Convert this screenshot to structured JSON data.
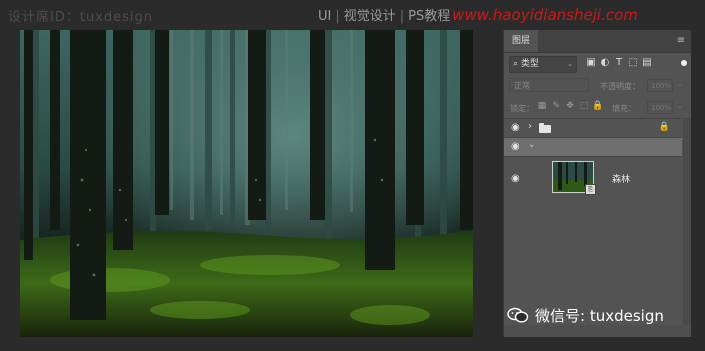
{
  "header": {
    "watermark_left": "设计席ID：tuxdesign",
    "nav_ui": "UI",
    "sep": "|",
    "nav_visual": "视觉设计",
    "nav_ps": "PS教程",
    "url": "www.haoyidiansheji.com"
  },
  "panel": {
    "tab_label": "图层",
    "menu_icon": "≡",
    "filter": {
      "icon": "⌕",
      "label": "类型",
      "arrow": "⌄"
    },
    "filter_icons": [
      "▣",
      "◐",
      "T",
      "⬚",
      "▤"
    ],
    "blend_mode": "正常",
    "opacity_label": "不透明度：",
    "opacity_value": "100%",
    "lock_label": "锁定：",
    "lock_icons": [
      "▦",
      "✎",
      "✥",
      "⬚",
      "🔒"
    ],
    "fill_label": "填充：",
    "fill_value": "100%",
    "dropdown_arrow": "⌄",
    "layers": [
      {
        "type": "group",
        "visible": true,
        "chevron": "›",
        "locked": true,
        "lock_icon": "🔒"
      },
      {
        "type": "group-open",
        "visible": true,
        "chevron": "⌄"
      },
      {
        "type": "image",
        "visible": true,
        "name": "森林",
        "badge": "⎘"
      }
    ]
  },
  "watermark": {
    "text": "微信号: tuxdesign"
  },
  "icons": {
    "eye": "eye-icon",
    "folder": "folder-icon",
    "lock": "lock-icon",
    "wechat": "wechat-icon"
  },
  "colors": {
    "panel_bg": "#535353",
    "selected_row": "#6e6e6e",
    "url_red": "#d01818",
    "canvas_forest": "#0d1411"
  }
}
